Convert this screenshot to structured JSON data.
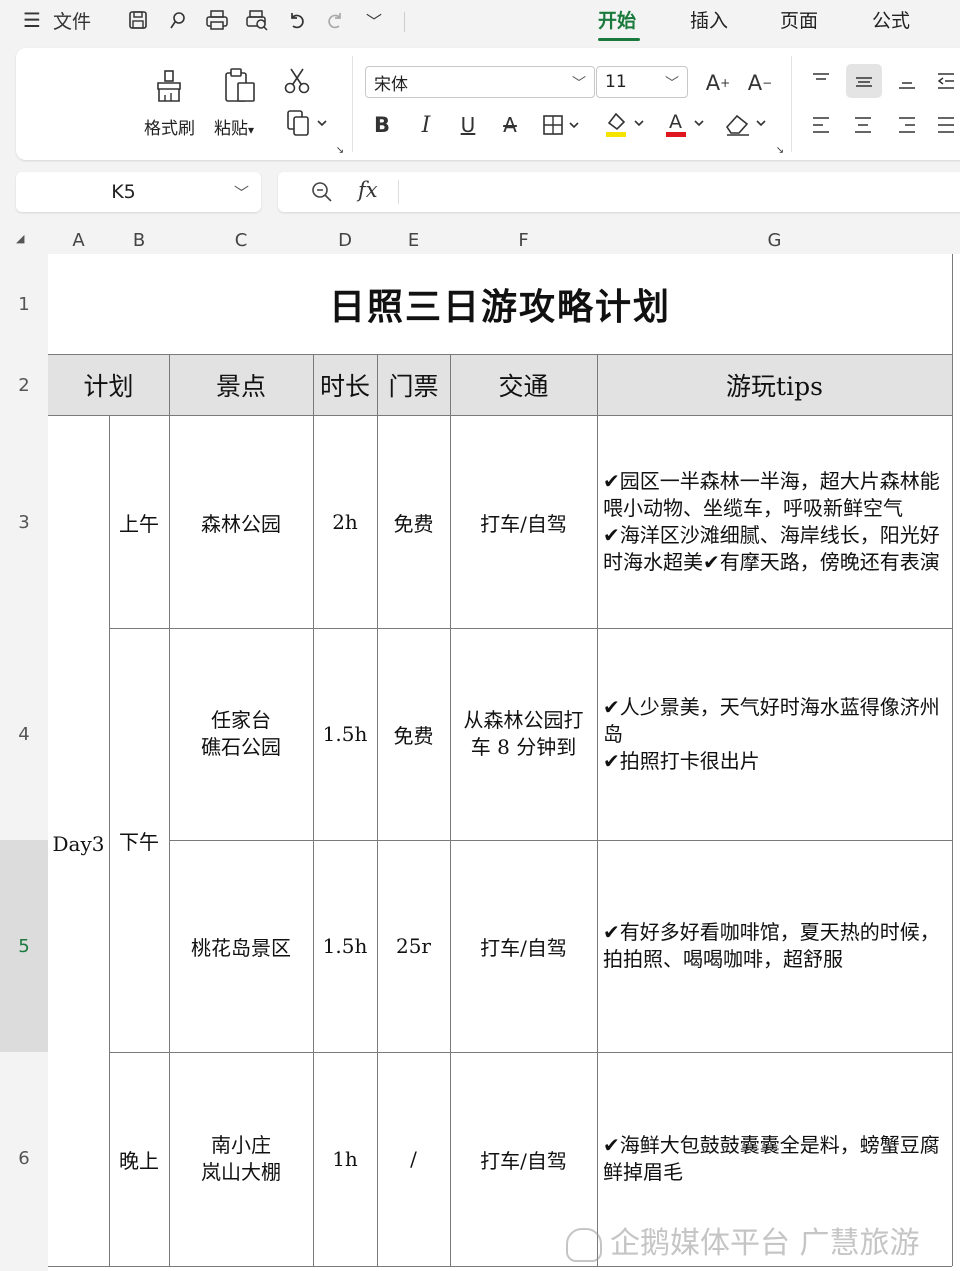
{
  "topbar": {
    "file_label": "文件",
    "tabs": [
      "开始",
      "插入",
      "页面",
      "公式"
    ]
  },
  "ribbon": {
    "format_painter": "格式刷",
    "paste": "粘贴",
    "font_name": "宋体",
    "font_size": "11",
    "fill_color": "#f5e400",
    "font_color": "#e0161e"
  },
  "formula_bar": {
    "name_box": "K5",
    "fx_label": "fx",
    "value": ""
  },
  "columns": [
    "A",
    "B",
    "C",
    "D",
    "E",
    "F",
    "G"
  ],
  "rows": [
    "1",
    "2",
    "3",
    "4",
    "5",
    "6"
  ],
  "sheet": {
    "title": "日照三日游攻略计划",
    "headers": {
      "plan": "计划",
      "spot": "景点",
      "duration": "时长",
      "ticket": "门票",
      "transport": "交通",
      "tips": "游玩tips"
    },
    "day": "Day3",
    "periods": {
      "morning": "上午",
      "afternoon": "下午",
      "evening": "晚上"
    },
    "items": [
      {
        "spot": "森林公园",
        "duration": "2h",
        "ticket": "免费",
        "transport": "打车/自驾",
        "tips": "✔园区一半森林一半海，超大片森林能喂小动物、坐缆车，呼吸新鲜空气\n✔海洋区沙滩细腻、海岸线长，阳光好时海水超美✔有摩天路，傍晚还有表演"
      },
      {
        "spot": "任家台\n礁石公园",
        "duration": "1.5h",
        "ticket": "免费",
        "transport": "从森林公园打车 8 分钟到",
        "tips": "✔人少景美，天气好时海水蓝得像济州岛\n✔拍照打卡很出片"
      },
      {
        "spot": "桃花岛景区",
        "duration": "1.5h",
        "ticket": "25r",
        "transport": "打车/自驾",
        "tips": "✔有好多好看咖啡馆，夏天热的时候，拍拍照、喝喝咖啡，超舒服"
      },
      {
        "spot": "南小庄\n岚山大棚",
        "duration": "1h",
        "ticket": "/",
        "transport": "打车/自驾",
        "tips": "✔海鲜大包鼓鼓囊囊全是料，螃蟹豆腐鲜掉眉毛"
      }
    ]
  },
  "watermark": "企鹅媒体平台 广慧旅游"
}
